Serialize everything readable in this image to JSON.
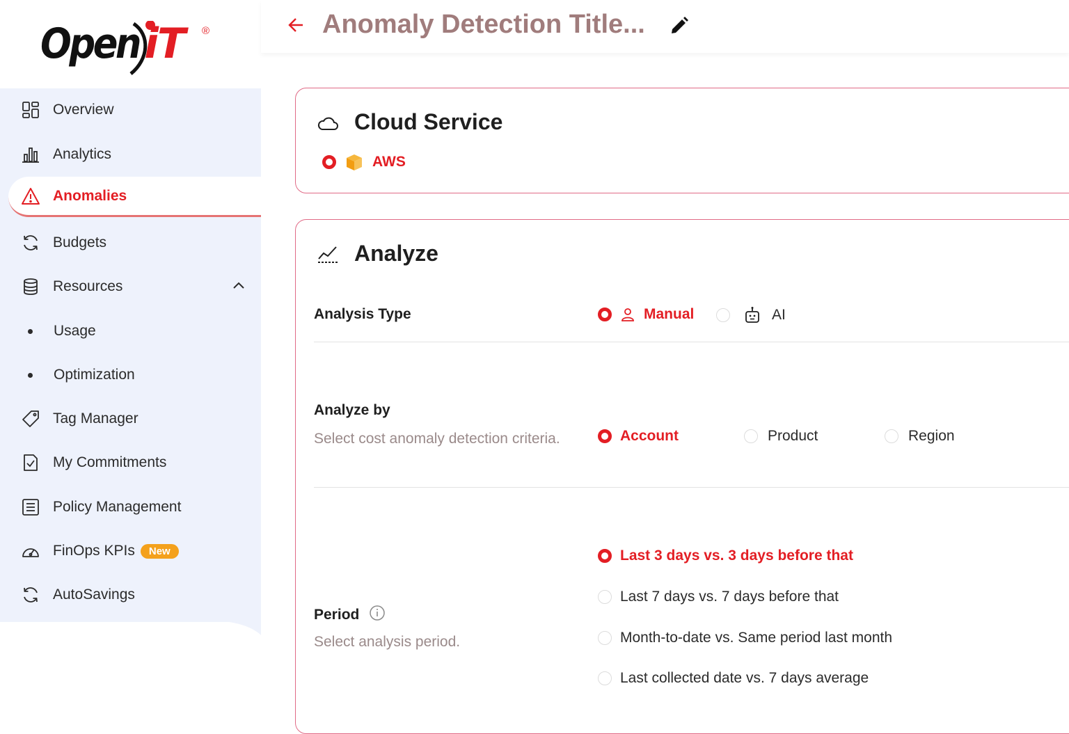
{
  "brand": {
    "name_part1": "Open",
    "name_part2": "iT",
    "registered": "®",
    "accent": "#e31e24"
  },
  "header": {
    "title": "Anomaly Detection Title...",
    "back_icon": "arrow-left-icon",
    "edit_icon": "pencil-icon"
  },
  "sidebar": {
    "items": [
      {
        "label": "Overview",
        "icon": "grid-icon"
      },
      {
        "label": "Analytics",
        "icon": "bar-chart-icon"
      },
      {
        "label": "Anomalies",
        "icon": "warning-icon",
        "active": true
      },
      {
        "label": "Budgets",
        "icon": "refresh-icon"
      },
      {
        "label": "Resources",
        "icon": "database-icon",
        "expanded": true
      },
      {
        "label": "Usage",
        "sub": true
      },
      {
        "label": "Optimization",
        "sub": true
      },
      {
        "label": "Tag Manager",
        "icon": "tag-icon"
      },
      {
        "label": "My Commitments",
        "icon": "check-document-icon"
      },
      {
        "label": "Policy Management",
        "icon": "list-document-icon"
      },
      {
        "label": "FinOps KPIs",
        "icon": "gauge-icon",
        "badge": "New"
      },
      {
        "label": "AutoSavings",
        "icon": "refresh-icon"
      }
    ]
  },
  "cloud_service": {
    "title": "Cloud Service",
    "selected": "AWS"
  },
  "analyze": {
    "title": "Analyze",
    "analysis_type": {
      "label": "Analysis Type",
      "options": [
        "Manual",
        "AI"
      ],
      "selected": "Manual"
    },
    "analyze_by": {
      "label": "Analyze by",
      "description": "Select cost anomaly detection criteria.",
      "options": [
        "Account",
        "Product",
        "Region"
      ],
      "selected": "Account"
    },
    "period": {
      "label": "Period",
      "description": "Select analysis period.",
      "options": [
        "Last 3 days vs. 3 days before that",
        "Last 7 days vs. 7 days before that",
        "Month-to-date vs. Same period last month",
        "Last collected date vs. 7 days average"
      ],
      "selected": "Last 3 days vs. 3 days before that"
    }
  }
}
